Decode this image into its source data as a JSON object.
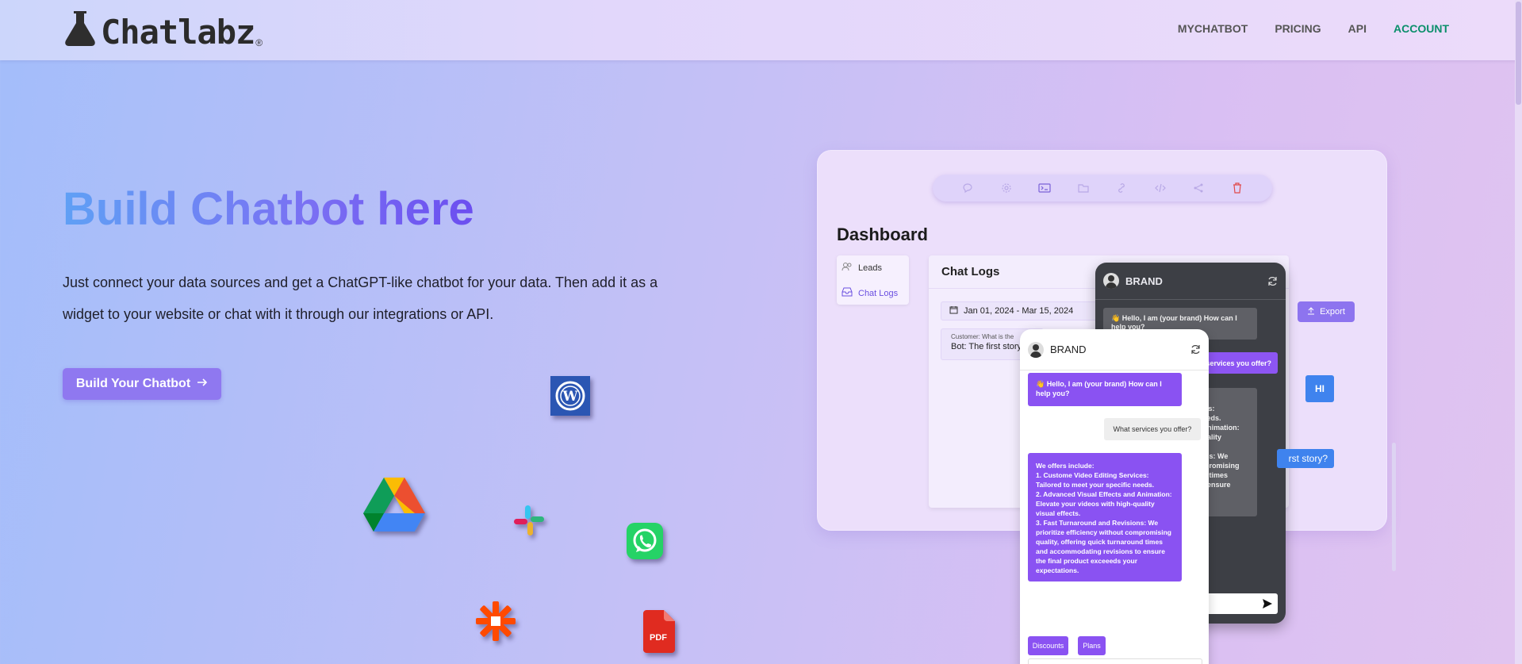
{
  "header": {
    "logo_text": "Chatlabz",
    "logo_reg": "®",
    "nav": [
      "MYCHATBOT",
      "PRICING",
      "API",
      "ACCOUNT"
    ],
    "active_nav": "ACCOUNT"
  },
  "hero": {
    "title": "Build Chatbot here",
    "description": "Just connect your data sources and get a ChatGPT-like chatbot for your data. Then add it as a widget to your website or chat with it through our integrations or API.",
    "cta_label": "Build Your Chatbot"
  },
  "integrations": [
    "wordpress-icon",
    "google-drive-icon",
    "slack-icon",
    "whatsapp-icon",
    "zapier-icon",
    "pdf-icon"
  ],
  "pdf_label": "PDF",
  "dashboard": {
    "title": "Dashboard",
    "toolbar_icons": [
      "chat-icon",
      "settings-icon",
      "terminal-icon",
      "folder-icon",
      "link-icon",
      "code-icon",
      "share-icon",
      "delete-icon"
    ],
    "sidebar": [
      {
        "label": "Leads",
        "icon": "users-icon"
      },
      {
        "label": "Chat Logs",
        "icon": "inbox-icon"
      }
    ],
    "chat_logs": {
      "title": "Chat Logs",
      "date_range": "Jan 01, 2024 - Mar 15, 2024",
      "customer_line": "Customer: What is the",
      "bot_line": "Bot: The first story",
      "export_label": "Export",
      "hi_label": "HI",
      "first_story": "rst story?"
    }
  },
  "dark_widget": {
    "brand": "BRAND",
    "greeting": "👋 Hello, I am (your brand) How can I help you?",
    "user_msg": "services you offer?",
    "reply_lines": [
      "ices:",
      "needs.",
      "l Animation:",
      "quality",
      "",
      "ions: We",
      "mpromising",
      "nd times",
      "to ensure",
      "r"
    ]
  },
  "light_widget": {
    "brand": "BRAND",
    "greeting": "👋 Hello, I am (your brand) How can I help you?",
    "user_msg": "What services you offer?",
    "reply_lines": [
      "We offers include:",
      "1. Custome Video Editing Services:",
      "Tailored to meet your specific needs.",
      "2. Advanced Visual Effects and Animation:",
      "Elevate your videos with high-quality",
      "visual effects.",
      "3. Fast Turnaround and Revisions: We",
      "prioritize efficiency without compromising",
      "quality, offering quick turnaround times",
      "and accommodating revisions to ensure",
      "the final product exceeeds your",
      "expectations."
    ],
    "chips": [
      "Discounts",
      "Plans"
    ]
  },
  "colors": {
    "accent": "#8f78f0",
    "account_green": "#0b8f6b",
    "bubble_purple": "#8a52f2",
    "dark_panel": "#3d3f45",
    "blue": "#3f83ee"
  }
}
